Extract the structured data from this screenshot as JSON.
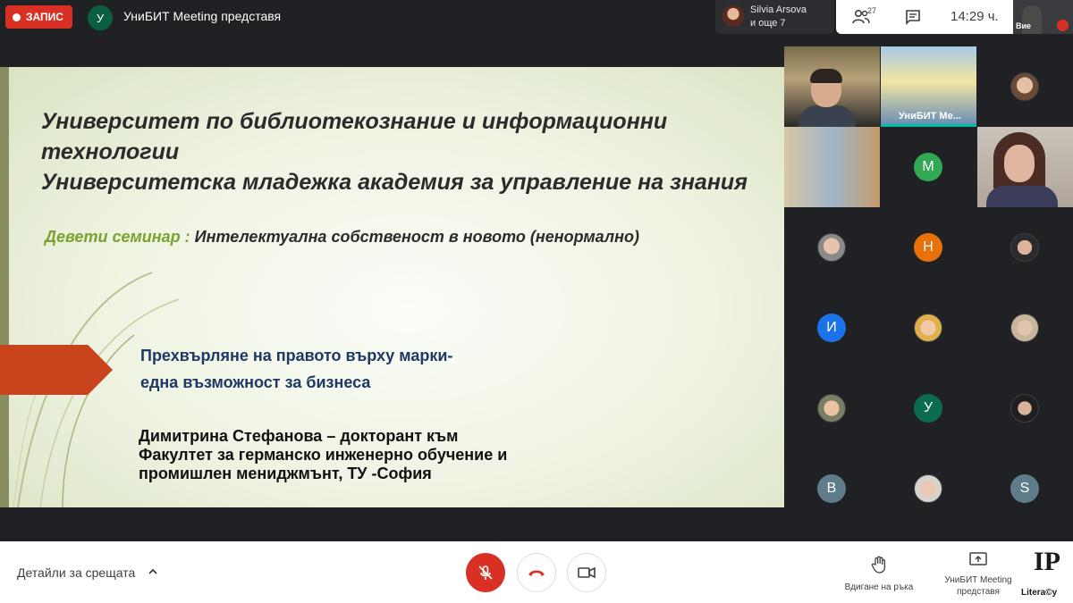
{
  "top_bar": {
    "recording_label": "ЗАПИС",
    "presenter_initial": "У",
    "presenter_text": "УниБИТ Meeting представя",
    "participant_name": "Silvia Arsova",
    "participant_more": "и още 7",
    "people_count": "27",
    "clock": "14:29 ч.",
    "self_label": "Вие"
  },
  "slide": {
    "title_line1": "Университет по библиотекознание и информационни технологии",
    "title_line2": "Университетска младежка академия за управление на знания",
    "seminar_label": "Девети семинар :",
    "seminar_title": " Интелектуална собственост в новото (ненормално)",
    "topic_line1": "Прехвърляне на правото върху марки-",
    "topic_line2": "една възможност за бизнеса",
    "author_line1": "Димитрина Стефанова – докторант към",
    "author_line2": "Факултет за германско инженерно обучение и",
    "author_line3": "промишлен мениджмънт, ТУ -София"
  },
  "grid": {
    "tile_label": "УниБИТ Ме...",
    "initials": [
      "М",
      "Н",
      "И",
      "У",
      "В",
      "S"
    ],
    "colors": {
      "M": "#33a852",
      "N": "#e8710a",
      "I": "#1a73e8",
      "U": "#0b6b4f",
      "V": "#5f7c8a",
      "S": "#5f7c8a"
    }
  },
  "bottom_bar": {
    "details_label": "Детайли за срещата",
    "raise_hand_label": "Вдигане на ръка",
    "present_label_line1": "УниБИТ Meeting",
    "present_label_line2": "представя",
    "logo_letters": "IP",
    "logo_sub": "Litera©y"
  },
  "icons": [
    "people-icon",
    "chat-icon",
    "mic-off-icon",
    "end-call-icon",
    "camera-icon",
    "hand-icon",
    "present-icon",
    "chevron-up-icon"
  ]
}
